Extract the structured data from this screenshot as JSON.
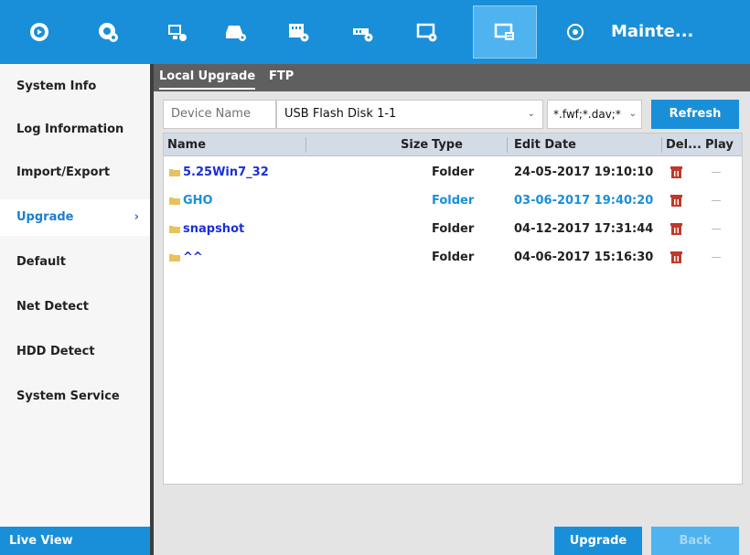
{
  "topbar": {
    "icons": [
      "playback-icon",
      "camera-settings-icon",
      "record-icon",
      "storage-icon",
      "video-settings-icon",
      "network-icon",
      "display-icon",
      "maintenance-icon"
    ],
    "title": "Mainte...",
    "active_color": "#4fb3ef",
    "bar_color": "#1a8fd9"
  },
  "sidebar": {
    "items": [
      {
        "label": "System Info"
      },
      {
        "label": "Log Information"
      },
      {
        "label": "Import/Export"
      },
      {
        "label": "Upgrade",
        "active": true
      },
      {
        "label": "Default"
      },
      {
        "label": "Net Detect"
      },
      {
        "label": "HDD Detect"
      },
      {
        "label": "System Service"
      }
    ],
    "live_view": "Live View"
  },
  "tabs": [
    {
      "label": "Local Upgrade",
      "active": true
    },
    {
      "label": "FTP"
    }
  ],
  "device": {
    "label": "Device Name",
    "value": "USB Flash Disk 1-1",
    "filter": "*.fwf;*.dav;*",
    "refresh": "Refresh"
  },
  "table": {
    "headers": {
      "name": "Name",
      "size": "Size",
      "type": "Type",
      "date": "Edit Date",
      "delete": "Del...",
      "play": "Play"
    },
    "rows": [
      {
        "name": "5.25Win7_32",
        "type": "Folder",
        "date": "24-05-2017 19:10:10"
      },
      {
        "name": "GHO",
        "type": "Folder",
        "date": "03-06-2017 19:40:20",
        "selected": true
      },
      {
        "name": "snapshot",
        "type": "Folder",
        "date": "04-12-2017 17:31:44"
      },
      {
        "name": "^^",
        "type": "Folder",
        "date": "04-06-2017 15:16:30"
      }
    ]
  },
  "actions": {
    "upgrade": "Upgrade",
    "back": "Back"
  }
}
